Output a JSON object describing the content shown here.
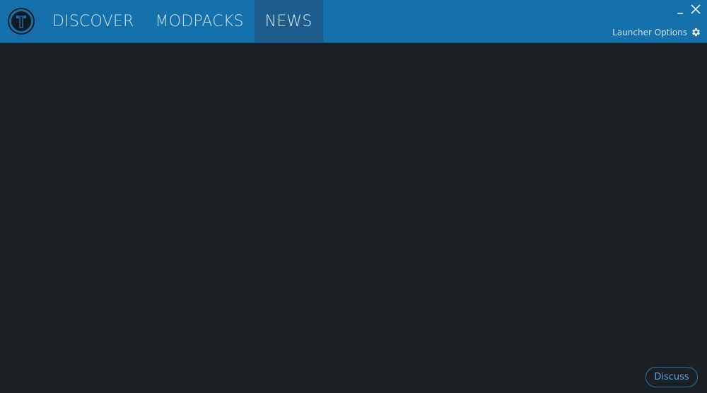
{
  "header": {
    "logo_icon": "technic-logo-icon",
    "tabs": [
      {
        "label": "DISCOVER",
        "active": false
      },
      {
        "label": "MODPACKS",
        "active": false
      },
      {
        "label": "NEWS",
        "active": true
      }
    ],
    "launcher_options_label": "Launcher Options",
    "launcher_options_icon": "gear-icon",
    "minimize_icon": "minimize-icon",
    "close_icon": "close-icon"
  },
  "footer": {
    "discuss_label": "Discuss"
  },
  "colors": {
    "header_bg": "#1570ab",
    "active_tab_bg": "#1d5d8d",
    "content_bg": "#1c2024",
    "accent": "#5ea7dc"
  }
}
